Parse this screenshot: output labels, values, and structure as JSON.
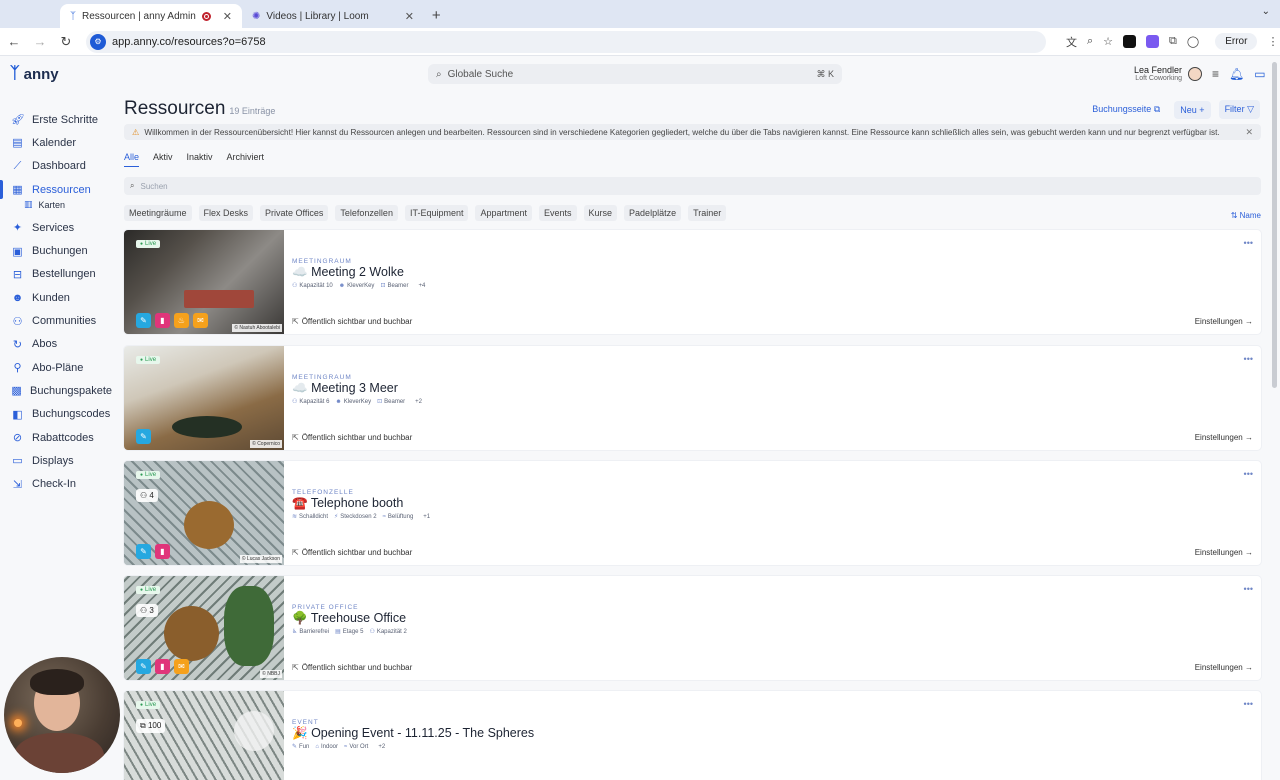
{
  "browser": {
    "tabs": [
      {
        "title": "Ressourcen | anny Admin",
        "active": true
      },
      {
        "title": "Videos | Library | Loom",
        "active": false
      }
    ],
    "url": "app.anny.co/resources?o=6758",
    "error_label": "Error"
  },
  "app": {
    "logo_text": "anny",
    "search_placeholder": "Globale Suche",
    "search_shortcut": "⌘ K",
    "user": {
      "name": "Lea Fendler",
      "org": "Loft Coworking"
    }
  },
  "sidebar": {
    "items": [
      {
        "label": "Erste Schritte",
        "icon": "rocket-icon"
      },
      {
        "label": "Kalender",
        "icon": "calendar-icon"
      },
      {
        "label": "Dashboard",
        "icon": "chart-icon"
      },
      {
        "label": "Ressourcen",
        "icon": "resources-icon",
        "active": true
      },
      {
        "label": "Karten",
        "icon": "map-icon",
        "sub": true
      },
      {
        "label": "Services",
        "icon": "wand-icon"
      },
      {
        "label": "Buchungen",
        "icon": "booking-icon"
      },
      {
        "label": "Bestellungen",
        "icon": "cart-icon"
      },
      {
        "label": "Kunden",
        "icon": "users-icon"
      },
      {
        "label": "Communities",
        "icon": "community-icon"
      },
      {
        "label": "Abos",
        "icon": "refresh-icon"
      },
      {
        "label": "Abo-Pläne",
        "icon": "plan-icon"
      },
      {
        "label": "Buchungspakete",
        "icon": "package-icon"
      },
      {
        "label": "Buchungscodes",
        "icon": "code-icon"
      },
      {
        "label": "Rabattcodes",
        "icon": "tag-icon"
      },
      {
        "label": "Displays",
        "icon": "display-icon"
      },
      {
        "label": "Check-In",
        "icon": "checkin-icon"
      }
    ]
  },
  "main": {
    "title": "Ressourcen",
    "count": "19 Einträge",
    "actions": {
      "booking_page": "Buchungsseite",
      "new": "Neu",
      "filter": "Filter"
    },
    "info": "Willkommen in der Ressourcenübersicht! Hier kannst du Ressourcen anlegen und bearbeiten. Ressourcen sind in verschiedene Kategorien gegliedert, welche du über die Tabs navigieren kannst. Eine Ressource kann schließlich alles sein, was gebucht werden kann und nur begrenzt verfügbar ist.",
    "tabs": [
      "Alle",
      "Aktiv",
      "Inaktiv",
      "Archiviert"
    ],
    "search_placeholder": "Suchen",
    "categories": [
      "Meetingräume",
      "Flex Desks",
      "Private Offices",
      "Telefonzellen",
      "IT-Equipment",
      "Appartment",
      "Events",
      "Kurse",
      "Padelplätze",
      "Trainer"
    ],
    "sort_label": "Name",
    "live_label": "Live",
    "visible_label": "Öffentlich sichtbar und buchbar",
    "settings_label": "Einstellungen",
    "resources": [
      {
        "category": "MEETINGRAUM",
        "emoji": "☁️",
        "title": "Meeting 2 Wolke",
        "features": [
          "Kapazität 10",
          "KleverKey",
          "Beamer"
        ],
        "more": "+4",
        "credit": "© Nastuh Abootalebi",
        "badges": [
          "blue",
          "pink",
          "orange",
          "orange"
        ],
        "count": ""
      },
      {
        "category": "MEETINGRAUM",
        "emoji": "☁️",
        "title": "Meeting 3 Meer",
        "features": [
          "Kapazität 6",
          "KleverKey",
          "Beamer"
        ],
        "more": "+2",
        "credit": "© Copernico",
        "badges": [
          "blue"
        ],
        "count": ""
      },
      {
        "category": "TELEFONZELLE",
        "emoji": "☎️",
        "title": "Telephone booth",
        "features": [
          "Schalldicht",
          "Steckdosen 2",
          "Belüftung"
        ],
        "more": "+1",
        "credit": "© Lucas Jackson",
        "badges": [
          "blue",
          "pink"
        ],
        "count": "4"
      },
      {
        "category": "PRIVATE OFFICE",
        "emoji": "🌳",
        "title": "Treehouse Office",
        "features": [
          "Barrierefrei",
          "Etage 5",
          "Kapazität 2"
        ],
        "more": "",
        "credit": "© NBBJ",
        "badges": [
          "blue",
          "pink",
          "orange",
          "orange"
        ],
        "count": "3"
      },
      {
        "category": "EVENT",
        "emoji": "🎉",
        "title": "Opening Event - 11.11.25 - The Spheres",
        "features": [
          "Fun",
          "Indoor",
          "Vor Ort"
        ],
        "more": "+2",
        "credit": "",
        "badges": [
          "blue",
          "pink"
        ],
        "count": "100"
      }
    ]
  }
}
